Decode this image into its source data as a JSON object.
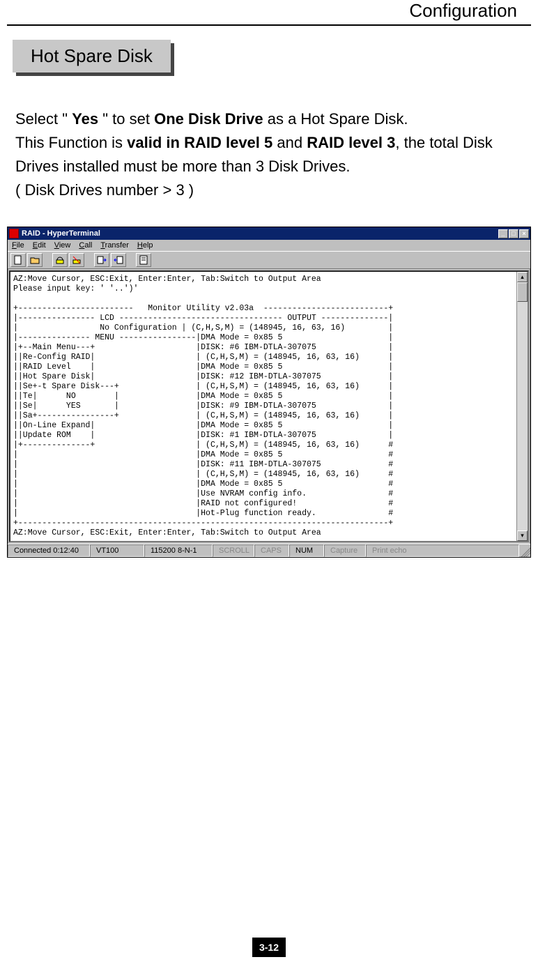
{
  "page": {
    "header": "Configuration",
    "section_title": "Hot Spare Disk",
    "page_number": "3-12"
  },
  "body": {
    "p1_a": "Select \" ",
    "p1_yes": "Yes",
    "p1_b": " \" to set ",
    "p1_one": "One Disk Drive",
    "p1_c": " as a Hot Spare Disk.",
    "p2_a": "This Function is ",
    "p2_valid": "valid in RAID level 5",
    "p2_b": " and ",
    "p2_raid3": "RAID level 3",
    "p2_c": ", the total Disk Drives installed must be more than 3 Disk Drives.",
    "p3": "( Disk Drives number > 3 )"
  },
  "window": {
    "title": "RAID - HyperTerminal",
    "menus": [
      "File",
      "Edit",
      "View",
      "Call",
      "Transfer",
      "Help"
    ],
    "status": {
      "connected": "Connected 0:12:40",
      "emulation": "VT100",
      "port": "115200 8-N-1",
      "scroll": "SCROLL",
      "caps": "CAPS",
      "num": "NUM",
      "capture": "Capture",
      "printecho": "Print echo"
    },
    "terminal_lines": [
      "AZ:Move Cursor, ESC:Exit, Enter:Enter, Tab:Switch to Output Area",
      "Please input key: ' '..')'",
      "",
      "+------------------------   Monitor Utility v2.03a  --------------------------+",
      "|---------------- LCD ---------------------------------- OUTPUT --------------|",
      "|                 No Configuration | (C,H,S,M) = (148945, 16, 63, 16)         |",
      "|--------------- MENU ----------------|DMA Mode = 0x85 5                      |",
      "|+--Main Menu---+                     |DISK: #6 IBM-DTLA-307075               |",
      "||Re-Config RAID|                     | (C,H,S,M) = (148945, 16, 63, 16)      |",
      "||RAID Level    |                     |DMA Mode = 0x85 5                      |",
      "||Hot Spare Disk|                     |DISK: #12 IBM-DTLA-307075              |",
      "||Se+-t Spare Disk---+                | (C,H,S,M) = (148945, 16, 63, 16)      |",
      "||Te|      NO        |                |DMA Mode = 0x85 5                      |",
      "||Se|      YES       |                |DISK: #9 IBM-DTLA-307075               |",
      "||Sa+----------------+                | (C,H,S,M) = (148945, 16, 63, 16)      |",
      "||On-Line Expand|                     |DMA Mode = 0x85 5                      |",
      "||Update ROM    |                     |DISK: #1 IBM-DTLA-307075               |",
      "|+--------------+                     | (C,H,S,M) = (148945, 16, 63, 16)      #",
      "|                                     |DMA Mode = 0x85 5                      #",
      "|                                     |DISK: #11 IBM-DTLA-307075              #",
      "|                                     | (C,H,S,M) = (148945, 16, 63, 16)      #",
      "|                                     |DMA Mode = 0x85 5                      #",
      "|                                     |Use NVRAM config info.                 #",
      "|                                     |RAID not configured!                   #",
      "|                                     |Hot-Plug function ready.               #",
      "+-----------------------------------------------------------------------------+",
      "AZ:Move Cursor, ESC:Exit, Enter:Enter, Tab:Switch to Output Area",
      ""
    ]
  }
}
